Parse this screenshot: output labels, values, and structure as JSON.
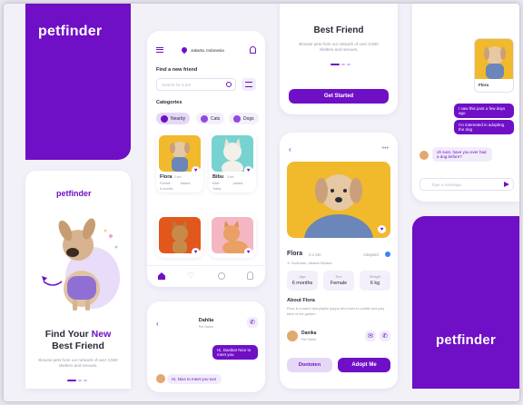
{
  "brand": {
    "name": "petfinder",
    "accent": "#6f0fc6"
  },
  "onboarding": {
    "title_line1": "Find Your ",
    "title_highlight": "New",
    "title_line2": "Best Friend",
    "subtitle": "Browse pets from our network of over 3,500 shelters and rescues.",
    "partial_title": "Best Friend",
    "partial_subtitle": "Browse pets from our network of over 3,500 shelters and rescues.",
    "cta": "Get Started"
  },
  "home": {
    "location": "Jakarta, Indonesia",
    "find_label": "Find a new friend",
    "search_placeholder": "Search for a pet",
    "categories_label": "Categories",
    "categories": [
      "Nearby",
      "Cats",
      "Dogs"
    ],
    "pets": [
      {
        "name": "Flora",
        "meta1": "2 km",
        "meta2": "Female",
        "meta3": "Jakarta",
        "meta4": "6 months"
      },
      {
        "name": "Bibu",
        "meta1": "3 km",
        "meta2": "Male",
        "meta3": "Jakarta",
        "meta4": "Tabby"
      }
    ]
  },
  "detail": {
    "name": "Flora",
    "distance": "2.1 km",
    "status": "Adopted",
    "address": "Jl. Sudirman, Jakarta Selatan",
    "stats": [
      {
        "label": "Age",
        "value": "6 months"
      },
      {
        "label": "Sex",
        "value": "Female"
      },
      {
        "label": "Weight",
        "value": "6 kg"
      }
    ],
    "about_label": "About Flora",
    "about_text": "Flora is a sweet and playful puppy who loves to cuddle and play fetch in the garden.",
    "owner_name": "Danika",
    "owner_role": "Pet Owner",
    "btn_secondary": "Dontoten",
    "btn_primary": "Adopt Me"
  },
  "chat_small": {
    "name": "Dahlia",
    "role": "Pet Owner",
    "msg_out": "Hi, Danika! Nice to meet you",
    "msg_in": "Hi, Nice to meet you too!"
  },
  "chat_right": {
    "pet_label": "Flora",
    "msg1": "I saw this post a few days ago",
    "msg2": "I'm interested in adopting the dog",
    "msg_in": "oh sure, have you ever had a dog before?",
    "input_placeholder": "Type a message"
  },
  "icons": [
    "menu-icon",
    "location-icon",
    "bell-icon",
    "search-icon",
    "filter-icon",
    "heart-icon",
    "home-icon",
    "chat-icon",
    "user-icon",
    "back-icon",
    "phone-icon",
    "more-icon",
    "send-icon",
    "verified-icon"
  ]
}
